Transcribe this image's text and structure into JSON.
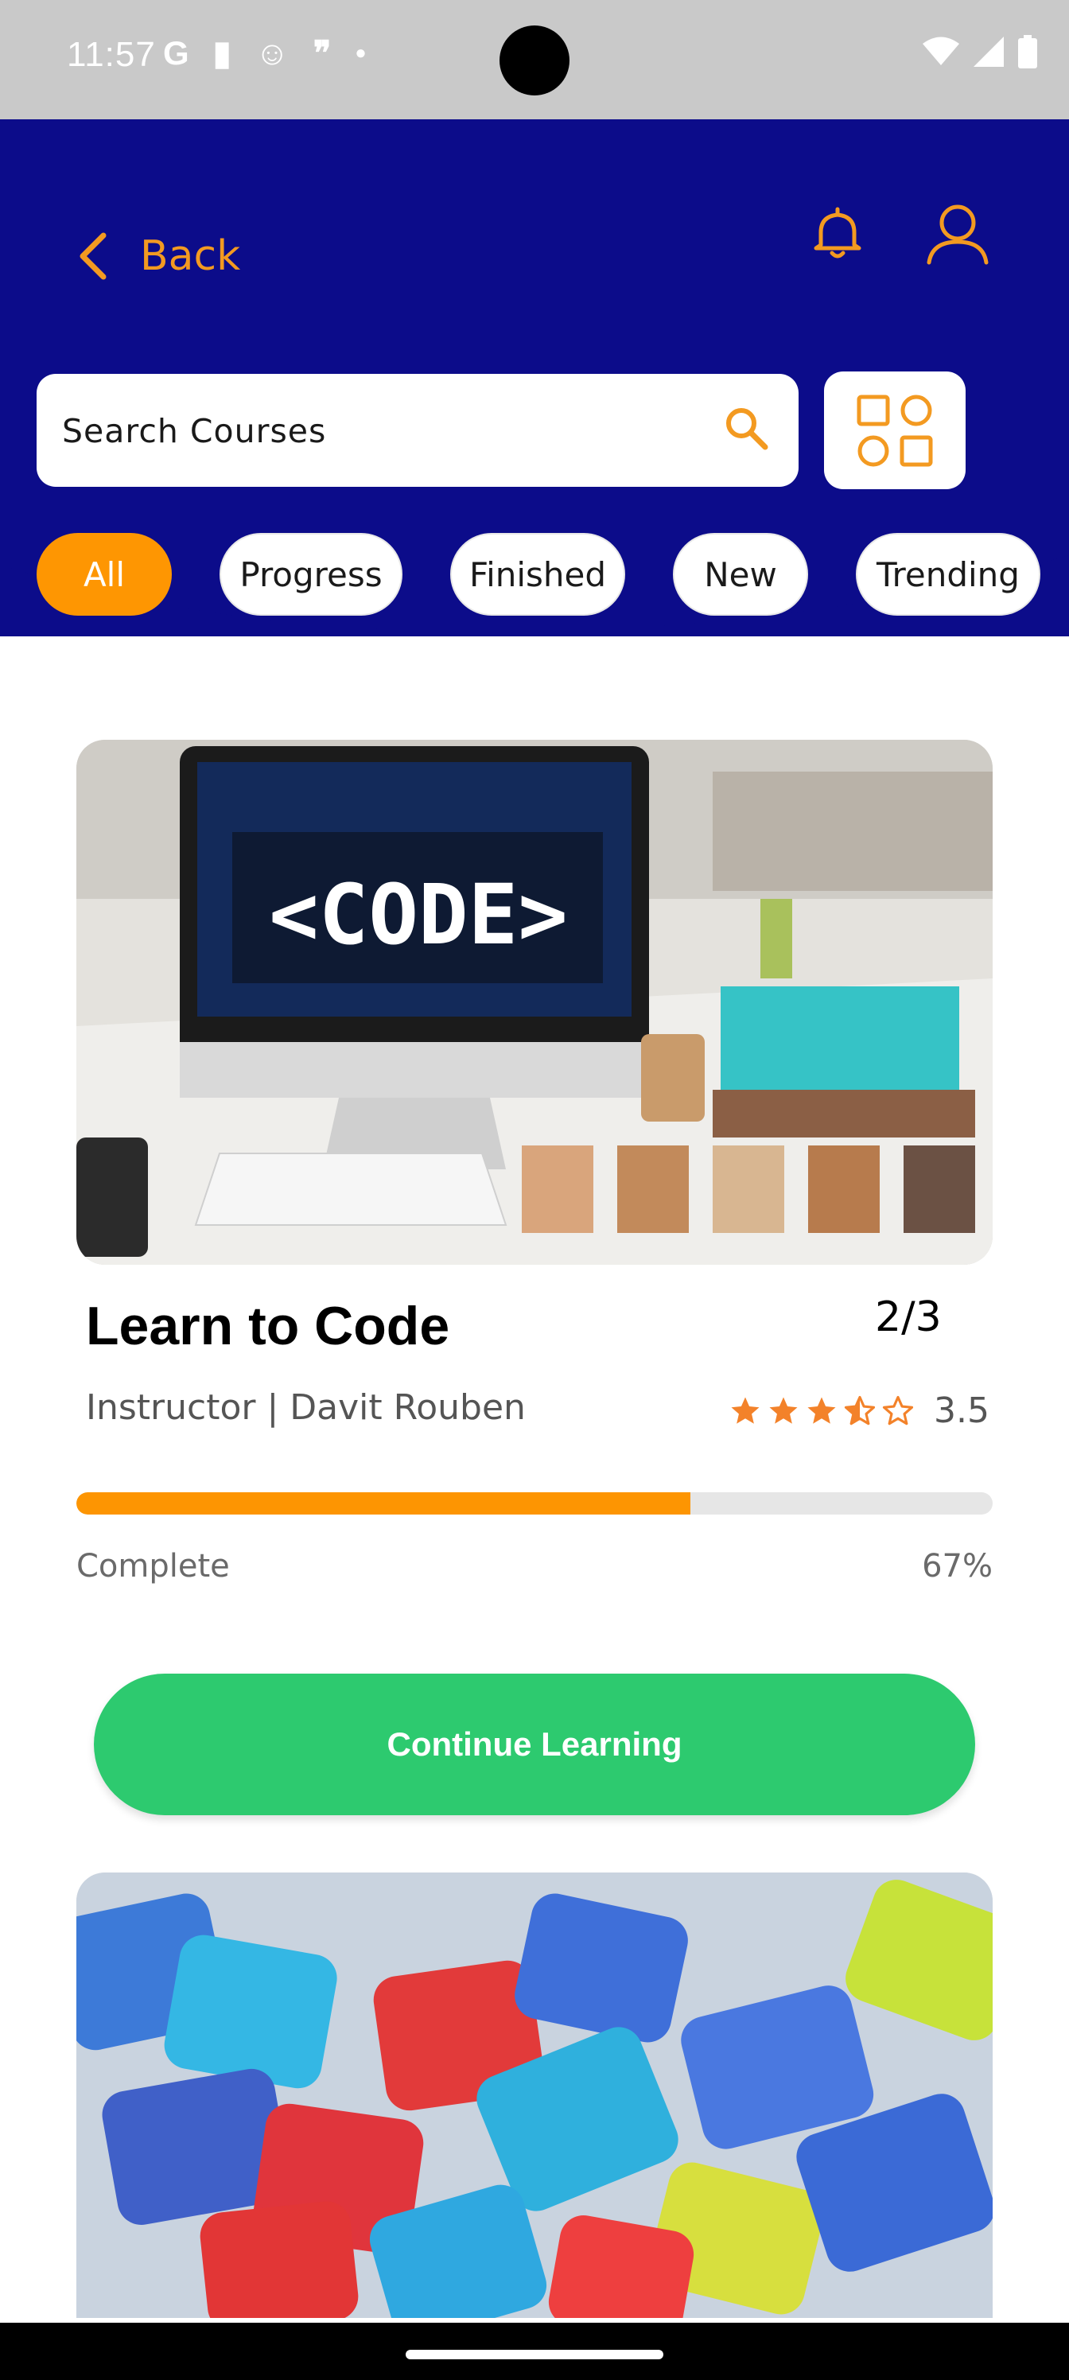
{
  "status_bar": {
    "time": "11:57",
    "icons_left": [
      "G",
      "notification-icon",
      "smiley-icon",
      "quote-icon",
      "dot-icon"
    ]
  },
  "header": {
    "back_label": "Back"
  },
  "search": {
    "placeholder": "Search Courses"
  },
  "filters": {
    "items": [
      {
        "label": "All",
        "active": true
      },
      {
        "label": "Progress",
        "active": false
      },
      {
        "label": "Finished",
        "active": false
      },
      {
        "label": "New",
        "active": false
      },
      {
        "label": "Trending",
        "active": false
      }
    ]
  },
  "course": {
    "title": "Learn to Code",
    "count": "2/3",
    "instructor": "Instructor | Davit Rouben",
    "rating_value": "3.5",
    "rating": 3.5,
    "rating_max": 5,
    "image_text": "<CODE>",
    "complete_label": "Complete",
    "complete_pct_text": "67%",
    "progress": 0.67
  },
  "cta": {
    "label": "Continue Learning"
  },
  "colors": {
    "header_bg": "#0c0c8a",
    "accent": "#fe9602",
    "cta": "#2dca6f"
  }
}
